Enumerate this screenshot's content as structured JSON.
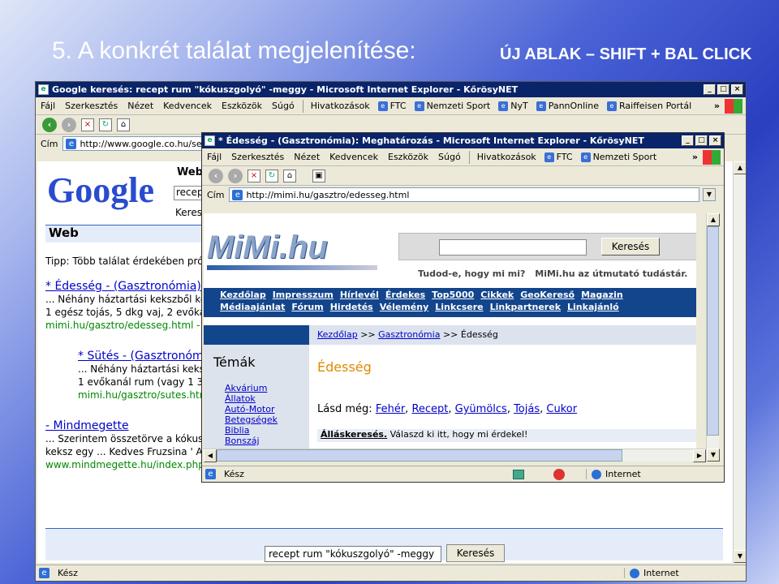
{
  "slide": {
    "title": "5. A konkrét találat megjelenítése:",
    "subtitle": "ÚJ ABLAK – SHIFT + BAL CLICK"
  },
  "back_window": {
    "title": "Google keresés: recept rum \"kókuszgolyó\" -meggy - Microsoft Internet Explorer - KőrösyNET",
    "menu": [
      "Fájl",
      "Szerkesztés",
      "Nézet",
      "Kedvencek",
      "Eszközök",
      "Súgó"
    ],
    "links": [
      "Hivatkozások",
      "FTC",
      "Nemzeti Sport",
      "NyT",
      "PannOnline",
      "Raiffeisen Portál"
    ],
    "address_label": "Cím",
    "address": "http://www.google.co.hu/searc",
    "google": {
      "logo": "Google",
      "tab": "Web",
      "query_prefix": "recep",
      "search_prefix": "Keres",
      "section": "Web",
      "tip": "Tipp: Több találat érdekében prób",
      "results": [
        {
          "title": "* Édesség - (Gasztronómia)",
          "line1": "... Néhány háztartási kekszből kéi",
          "line2": "1 egész tojás, 5 dkg vaj, 2 evőkar",
          "url": "mimi.hu/gasztro/edesseg.html - 3"
        },
        {
          "title": "* Sütés - (Gasztronóm",
          "line1": "... Néhány háztartási keks",
          "line2": "1 evőkanál rum (vagy 1 3/4",
          "url": "mimi.hu/gasztro/sutes.htm"
        },
        {
          "title": "- Mindmegette",
          "line1": "... Szerintem összetörve a kókus",
          "line2": "keksz egy ... Kedves Fruzsina ' A",
          "url": "www.mindmegette.hu/index.php?"
        }
      ],
      "bottom_query": "recept rum \"kókuszgolyó\" -meggy",
      "bottom_button": "Keresés"
    },
    "status_left": "Kész",
    "status_right": "Internet"
  },
  "front_window": {
    "title": "* Édesség - (Gasztronómia): Meghatározás - Microsoft Internet Explorer - KőrösyNET",
    "menu": [
      "Fájl",
      "Szerkesztés",
      "Nézet",
      "Kedvencek",
      "Eszközök",
      "Súgó"
    ],
    "links": [
      "Hivatkozások",
      "FTC",
      "Nemzeti Sport"
    ],
    "address_label": "Cím",
    "address": "http://mimi.hu/gasztro/edesseg.html",
    "mimi": {
      "logo": "MiMi.hu",
      "search_button": "Keresés",
      "tagline_q": "Tudod-e, hogy mi mi?",
      "tagline": "MiMi.hu az útmutató tudástár.",
      "nav1": [
        "Kezdőlap",
        "Impresszum",
        "Hírlevél",
        "Érdekes",
        "Top5000",
        "Cikkek",
        "GeoKereső",
        "Magazin"
      ],
      "nav2": [
        "Médiaajánlat",
        "Fórum",
        "Hirdetés",
        "Vélemény",
        "Linkcsere",
        "Linkpartnerek",
        "Linkajánló"
      ],
      "crumbs": [
        "Kezdőlap",
        ">>",
        "Gasztronómia",
        ">> Édesség"
      ],
      "sidebar_title": "Témák",
      "sidebar": [
        "Akvárium",
        "Állatok",
        "Autó-Motor",
        "Betegségek",
        "Biblia",
        "Bonszáj"
      ],
      "heading": "Édesség",
      "see_also_label": "Lásd még:",
      "see_also": [
        "Fehér",
        "Recept",
        "Gyümölcs",
        "Tojás",
        "Cukor"
      ],
      "job_bold": "Álláskeresés.",
      "job_text": "Válaszd ki itt, hogy mi érdekel!"
    },
    "status_left": "Kész",
    "status_right": "Internet"
  }
}
